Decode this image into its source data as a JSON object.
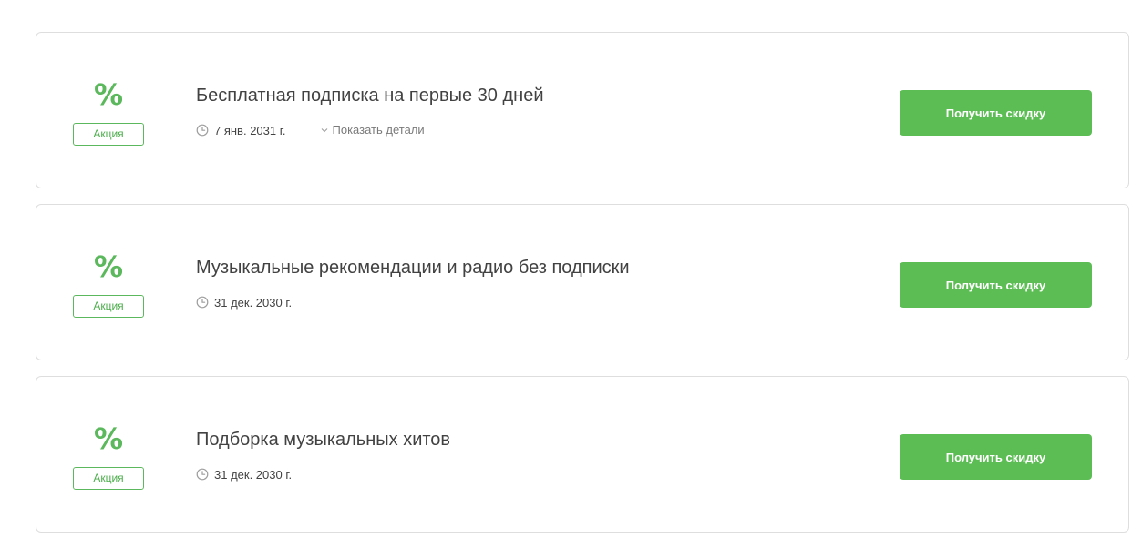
{
  "colors": {
    "accent": "#5cbd54",
    "border": "#dedede",
    "text": "#424242",
    "muted": "#7a7a7a"
  },
  "offers": [
    {
      "badge_symbol": "%",
      "tag": "Акция",
      "title": "Бесплатная подписка на первые 30 дней",
      "date": "7 янв. 2031 г.",
      "details_label": "Показать детали",
      "button_label": "Получить скидку"
    },
    {
      "badge_symbol": "%",
      "tag": "Акция",
      "title": "Музыкальные рекомендации и радио без подписки",
      "date": "31 дек. 2030 г.",
      "button_label": "Получить скидку"
    },
    {
      "badge_symbol": "%",
      "tag": "Акция",
      "title": "Подборка музыкальных хитов",
      "date": "31 дек. 2030 г.",
      "button_label": "Получить скидку"
    }
  ]
}
